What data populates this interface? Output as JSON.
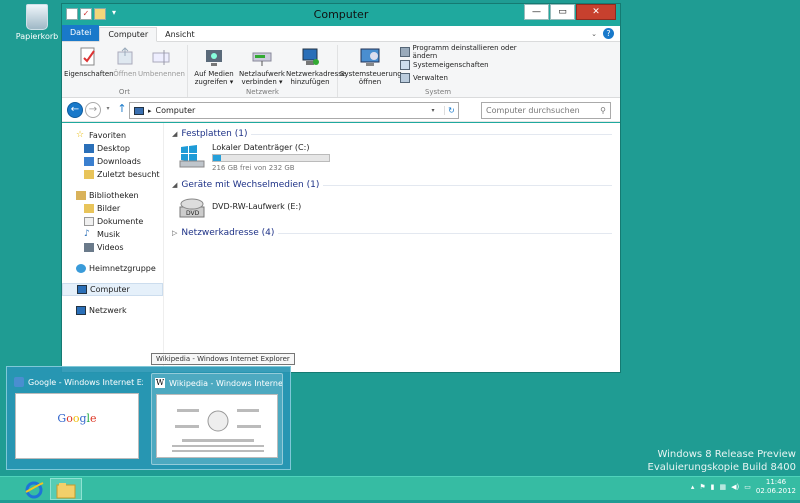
{
  "desktop": {
    "recycle_bin_label": "Papierkorb"
  },
  "watermark": {
    "line1": "Windows 8 Release Preview",
    "line2": "Evaluierungskopie Build 8400"
  },
  "window": {
    "title": "Computer",
    "tabs": {
      "file": "Datei",
      "computer": "Computer",
      "view": "Ansicht"
    },
    "ribbon": {
      "location": {
        "label": "Ort",
        "properties": "Eigenschaften",
        "open": "Öffnen",
        "rename": "Umbenennen"
      },
      "network": {
        "label": "Netzwerk",
        "media_line1": "Auf Medien",
        "media_line2": "zugreifen ▾",
        "map_line1": "Netzlaufwerk",
        "map_line2": "verbinden ▾",
        "add_line1": "Netzwerkadresse",
        "add_line2": "hinzufügen"
      },
      "system": {
        "label": "System",
        "cp_line1": "Systemsteuerung",
        "cp_line2": "öffnen",
        "uninstall": "Programm deinstallieren oder ändern",
        "sysprops": "Systemeigenschaften",
        "manage": "Verwalten"
      }
    },
    "address": {
      "path": "Computer",
      "search_placeholder": "Computer durchsuchen"
    },
    "sidebar": {
      "favorites": "Favoriten",
      "desktop": "Desktop",
      "downloads": "Downloads",
      "recent": "Zuletzt besucht",
      "libraries": "Bibliotheken",
      "pictures": "Bilder",
      "documents": "Dokumente",
      "music": "Musik",
      "videos": "Videos",
      "homegroup": "Heimnetzgruppe",
      "computer": "Computer",
      "network": "Netzwerk"
    },
    "content": {
      "hdd_group": "Festplatten (1)",
      "drive_c": {
        "name": "Lokaler Datenträger (C:)",
        "free": "216 GB frei von 232 GB",
        "used_fraction": 0.07
      },
      "removable_group": "Geräte mit Wechselmedien (1)",
      "dvd": {
        "name": "DVD-RW-Laufwerk (E:)"
      },
      "netaddr_group": "Netzwerkadresse (4)"
    }
  },
  "taskbar": {
    "tooltip": "Wikipedia - Windows Internet Explorer",
    "thumb1": "Google - Windows Internet Expl...",
    "thumb2": "Wikipedia - Windows Internet E...",
    "time": "11:46",
    "date": "02.06.2012"
  },
  "colors": {
    "desktop": "#1f9c93",
    "accent": "#1979ca",
    "taskbar": "#36bca3"
  }
}
